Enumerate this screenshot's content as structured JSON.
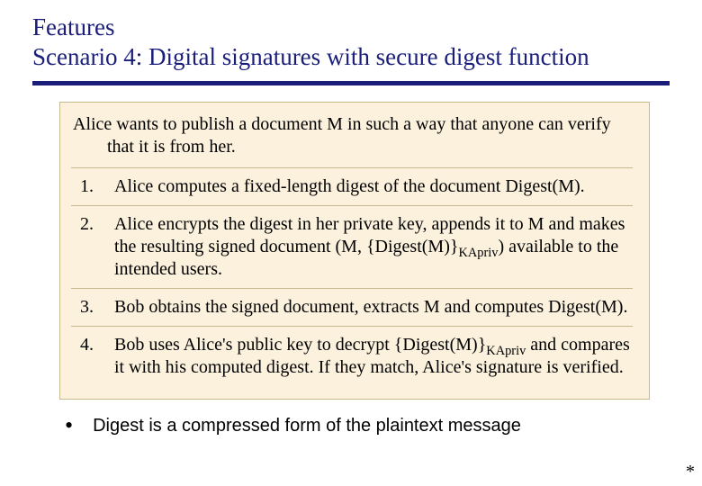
{
  "title": {
    "line1": "Features",
    "line2": "Scenario 4: Digital signatures with secure digest function"
  },
  "intro": "Alice wants to publish a document M in such a way that anyone can verify that it is from her.",
  "steps": [
    {
      "text": "Alice computes a fixed-length digest of the document Digest(M)."
    },
    {
      "pre": "Alice encrypts the digest in her private key, appends it to M and makes the resulting signed document (M, {Digest(M)}",
      "sub": "KApriv",
      "post": ") available to the intended users."
    },
    {
      "text": "Bob obtains the signed document, extracts M and computes Digest(M)."
    },
    {
      "pre": "Bob uses Alice's public key  to decrypt {Digest(M)}",
      "sub": "KApriv",
      "post": " and compares it with his computed digest.  If they match, Alice's signature is verified."
    }
  ],
  "bullet": "Digest is a compressed form of the plaintext message",
  "footer": "*"
}
